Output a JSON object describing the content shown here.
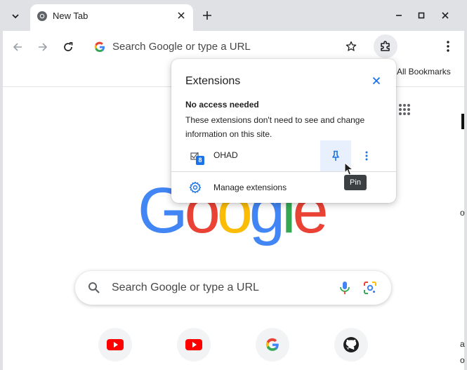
{
  "tab": {
    "title": "New Tab",
    "close_glyph": "✕"
  },
  "window": {
    "new_tab_glyph": "+",
    "minimize_icon": "minimize-icon",
    "maximize_icon": "maximize-icon",
    "close_icon": "close-icon"
  },
  "toolbar": {
    "omnibox_placeholder": "Search Google or type a URL"
  },
  "bookmarks": {
    "all_bookmarks_label": "All Bookmarks"
  },
  "search": {
    "placeholder": "Search Google or type a URL"
  },
  "logo": {
    "letters": [
      "G",
      "o",
      "o",
      "g",
      "l",
      "e"
    ]
  },
  "extensions_popup": {
    "title": "Extensions",
    "section_heading": "No access needed",
    "section_description": "These extensions don't need to see and change information on this site.",
    "items": [
      {
        "name": "OHAD",
        "badge": "8"
      }
    ],
    "manage_label": "Manage extensions"
  },
  "tooltip": {
    "text": "Pin"
  },
  "shortcuts": [
    {
      "icon": "youtube-icon"
    },
    {
      "icon": "youtube-icon"
    },
    {
      "icon": "google-icon"
    },
    {
      "icon": "github-icon"
    }
  ],
  "colors": {
    "accent": "#1a73e8",
    "google_blue": "#4285f4",
    "google_red": "#ea4335",
    "google_yellow": "#fbbc05",
    "google_green": "#34a853",
    "youtube_red": "#ff0000"
  }
}
